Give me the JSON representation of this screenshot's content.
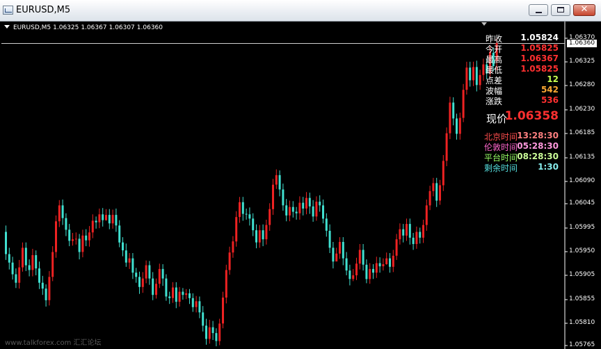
{
  "window": {
    "title": "EURUSD,M5",
    "buttons": {
      "minimize": "minimize-icon",
      "maximize": "maximize-icon",
      "close": "✕"
    }
  },
  "chart_header": {
    "symbol": "EURUSD,M5",
    "open": "1.06325",
    "high": "1.06367",
    "low": "1.06307",
    "close": "1.06360"
  },
  "info_panel": {
    "rows": [
      {
        "label": "昨收",
        "value": "1.05824",
        "color": "#ffffff"
      },
      {
        "label": "今开",
        "value": "1.05825",
        "color": "#ff3030"
      },
      {
        "label": "最高",
        "value": "1.06367",
        "color": "#ff3030"
      },
      {
        "label": "最低",
        "value": "1.05825",
        "color": "#ff3030"
      },
      {
        "label": "点差",
        "value": "12",
        "color": "#c8ff50"
      },
      {
        "label": "波幅",
        "value": "542",
        "color": "#ffaa33"
      },
      {
        "label": "涨跌",
        "value": "536",
        "color": "#ff3030"
      }
    ],
    "current_price": {
      "label": "现价",
      "value": "1.06358"
    },
    "times": [
      {
        "label": "北京时间",
        "value": "13:28:30",
        "label_color": "#ff4d4d",
        "value_color": "#ff8080"
      },
      {
        "label": "伦敦时间",
        "value": "05:28:30",
        "label_color": "#ff66cc",
        "value_color": "#ff99dd"
      },
      {
        "label": "平台时间",
        "value": "08:28:30",
        "label_color": "#99ff66",
        "value_color": "#ccff99"
      },
      {
        "label": "剩余时间",
        "value": "1:30",
        "label_color": "#55dddd",
        "value_color": "#88eeee"
      }
    ]
  },
  "price_axis": {
    "labels": [
      "1.06370",
      "1.06325",
      "1.06280",
      "1.06230",
      "1.06185",
      "1.06135",
      "1.06090",
      "1.06045",
      "1.05995",
      "1.05950",
      "1.05905",
      "1.05855",
      "1.05810",
      "1.05765"
    ],
    "current_price_tag": "1.06360",
    "current_price_line": 1.0636
  },
  "colors": {
    "bull": "#ee2222",
    "bear": "#40e0d0",
    "background": "#000000",
    "grid": "#ffffff"
  },
  "chart_data": {
    "type": "candlestick",
    "title": "EURUSD,M5",
    "ylim": [
      1.0576,
      1.0642
    ],
    "candles": [
      [
        1.06002,
        1.0596,
        1.06014,
        1.05949
      ],
      [
        1.0596,
        1.05944,
        1.05972,
        1.05931
      ],
      [
        1.05944,
        1.05922,
        1.05955,
        1.05912
      ],
      [
        1.05922,
        1.05906,
        1.05933,
        1.05896
      ],
      [
        1.05906,
        1.05935,
        1.05949,
        1.05895
      ],
      [
        1.05935,
        1.05972,
        1.05982,
        1.05927
      ],
      [
        1.05972,
        1.05939,
        1.05982,
        1.05928
      ],
      [
        1.05939,
        1.0593,
        1.0595,
        1.05918
      ],
      [
        1.0593,
        1.05958,
        1.0597,
        1.05918
      ],
      [
        1.05958,
        1.05933,
        1.05967,
        1.0592
      ],
      [
        1.05933,
        1.05906,
        1.05946,
        1.05894
      ],
      [
        1.05906,
        1.05895,
        1.05919,
        1.05883
      ],
      [
        1.05895,
        1.05873,
        1.05903,
        1.05861
      ],
      [
        1.05873,
        1.05917,
        1.05928,
        1.05863
      ],
      [
        1.05917,
        1.05964,
        1.05975,
        1.05909
      ],
      [
        1.05964,
        1.06022,
        1.06033,
        1.05953
      ],
      [
        1.06022,
        1.06052,
        1.06062,
        1.06011
      ],
      [
        1.06052,
        1.06028,
        1.06063,
        1.06015
      ],
      [
        1.06028,
        1.06006,
        1.06037,
        1.05994
      ],
      [
        1.06006,
        1.05985,
        1.06017,
        1.05975
      ],
      [
        1.05985,
        1.05988,
        1.06,
        1.05976
      ],
      [
        1.05988,
        1.05989,
        1.06001,
        1.05978
      ],
      [
        1.05989,
        1.05964,
        1.05998,
        1.0595
      ],
      [
        1.05964,
        1.05995,
        1.06006,
        1.05954
      ],
      [
        1.05995,
        1.05986,
        1.06007,
        1.05975
      ],
      [
        1.05986,
        1.06001,
        1.06013,
        1.05974
      ],
      [
        1.06001,
        1.06023,
        1.06035,
        1.0599
      ],
      [
        1.06023,
        1.0602,
        1.06031,
        1.06008
      ],
      [
        1.0602,
        1.06035,
        1.06046,
        1.06009
      ],
      [
        1.06035,
        1.06024,
        1.06047,
        1.06012
      ],
      [
        1.06024,
        1.06034,
        1.06045,
        1.06023
      ],
      [
        1.06034,
        1.06018,
        1.06045,
        1.06007
      ],
      [
        1.06018,
        1.06034,
        1.06044,
        1.06008
      ],
      [
        1.06034,
        1.06014,
        1.06046,
        1.06002
      ],
      [
        1.06014,
        1.05982,
        1.06024,
        1.05973
      ],
      [
        1.05982,
        1.05967,
        1.05992,
        1.05956
      ],
      [
        1.05967,
        1.05944,
        1.0598,
        1.05936
      ],
      [
        1.05944,
        1.05952,
        1.05962,
        1.05932
      ],
      [
        1.05952,
        1.05925,
        1.05962,
        1.05913
      ],
      [
        1.05925,
        1.05917,
        1.05934,
        1.05906
      ],
      [
        1.05917,
        1.05898,
        1.05927,
        1.05885
      ],
      [
        1.05898,
        1.05914,
        1.05926,
        1.05887
      ],
      [
        1.05914,
        1.05939,
        1.05948,
        1.05905
      ],
      [
        1.05939,
        1.05914,
        1.05947,
        1.05902
      ],
      [
        1.05914,
        1.05883,
        1.05926,
        1.05873
      ],
      [
        1.05883,
        1.05904,
        1.05914,
        1.05876
      ],
      [
        1.05904,
        1.05932,
        1.05942,
        1.05896
      ],
      [
        1.05932,
        1.05914,
        1.05941,
        1.059
      ],
      [
        1.05914,
        1.0588,
        1.05922,
        1.05872
      ],
      [
        1.0588,
        1.05877,
        1.05889,
        1.05866
      ],
      [
        1.05877,
        1.05897,
        1.05907,
        1.05868
      ],
      [
        1.05897,
        1.0587,
        1.05907,
        1.05858
      ],
      [
        1.0587,
        1.05889,
        1.05898,
        1.05861
      ],
      [
        1.05889,
        1.05883,
        1.05896,
        1.05874
      ],
      [
        1.05883,
        1.05886,
        1.05894,
        1.05875
      ],
      [
        1.05886,
        1.05877,
        1.05894,
        1.05866
      ],
      [
        1.05877,
        1.0586,
        1.05886,
        1.05851
      ],
      [
        1.0586,
        1.05871,
        1.05881,
        1.0585
      ],
      [
        1.05871,
        1.0585,
        1.0588,
        1.05839
      ],
      [
        1.0585,
        1.05825,
        1.05862,
        1.05814
      ],
      [
        1.05825,
        1.058,
        1.05838,
        1.05789
      ],
      [
        1.058,
        1.05822,
        1.05836,
        1.05791
      ],
      [
        1.05822,
        1.05811,
        1.05834,
        1.05798
      ],
      [
        1.05811,
        1.05796,
        1.0582,
        1.05786
      ],
      [
        1.05796,
        1.05829,
        1.05838,
        1.05788
      ],
      [
        1.05829,
        1.05878,
        1.05889,
        1.0582
      ],
      [
        1.05878,
        1.0593,
        1.0594,
        1.05867
      ],
      [
        1.0593,
        1.05963,
        1.05974,
        1.05921
      ],
      [
        1.05963,
        1.05984,
        1.05994,
        1.05953
      ],
      [
        1.05984,
        1.0603,
        1.06041,
        1.05974
      ],
      [
        1.0603,
        1.06058,
        1.06068,
        1.06019
      ],
      [
        1.06058,
        1.06036,
        1.06068,
        1.06023
      ],
      [
        1.06036,
        1.06035,
        1.06046,
        1.06025
      ],
      [
        1.06035,
        1.06027,
        1.06048,
        1.06014
      ],
      [
        1.06027,
        1.06005,
        1.06037,
        1.05994
      ],
      [
        1.06005,
        1.05982,
        1.06016,
        1.05971
      ],
      [
        1.05982,
        1.06005,
        1.06015,
        1.05972
      ],
      [
        1.06005,
        1.05988,
        1.06016,
        1.05975
      ],
      [
        1.05988,
        1.06015,
        1.06025,
        1.05978
      ],
      [
        1.06015,
        1.06045,
        1.06056,
        1.06004
      ],
      [
        1.06045,
        1.06091,
        1.06102,
        1.06034
      ],
      [
        1.06091,
        1.06109,
        1.0612,
        1.06083
      ],
      [
        1.06109,
        1.06082,
        1.06118,
        1.06069
      ],
      [
        1.06082,
        1.06052,
        1.06093,
        1.06042
      ],
      [
        1.06052,
        1.06033,
        1.06064,
        1.06022
      ],
      [
        1.06033,
        1.06049,
        1.06061,
        1.06022
      ],
      [
        1.06049,
        1.0604,
        1.0606,
        1.06029
      ],
      [
        1.0604,
        1.06037,
        1.06049,
        1.06025
      ],
      [
        1.06037,
        1.06057,
        1.06069,
        1.06025
      ],
      [
        1.06057,
        1.06046,
        1.06068,
        1.06033
      ],
      [
        1.06046,
        1.06066,
        1.06077,
        1.06035
      ],
      [
        1.06066,
        1.0605,
        1.06076,
        1.06036
      ],
      [
        1.0605,
        1.06031,
        1.06062,
        1.06021
      ],
      [
        1.06031,
        1.06059,
        1.06069,
        1.06023
      ],
      [
        1.06059,
        1.06052,
        1.06071,
        1.0604
      ],
      [
        1.06052,
        1.06027,
        1.06063,
        1.06018
      ],
      [
        1.06027,
        1.06004,
        1.06037,
        1.05993
      ],
      [
        1.06004,
        1.05972,
        1.06016,
        1.05962
      ],
      [
        1.05972,
        1.05946,
        1.05983,
        1.05933
      ],
      [
        1.05946,
        1.05961,
        1.05972,
        1.05952
      ],
      [
        1.05961,
        1.05983,
        1.05992,
        1.05951
      ],
      [
        1.05983,
        1.05952,
        1.05992,
        1.05939
      ],
      [
        1.05952,
        1.05929,
        1.05964,
        1.0592
      ],
      [
        1.05929,
        1.05913,
        1.0594,
        1.05901
      ],
      [
        1.05913,
        1.0592,
        1.05932,
        1.05909
      ],
      [
        1.0592,
        1.05942,
        1.05953,
        1.05911
      ],
      [
        1.05942,
        1.05968,
        1.05979,
        1.05931
      ],
      [
        1.05968,
        1.0594,
        1.05979,
        1.05929
      ],
      [
        1.0594,
        1.05913,
        1.0595,
        1.05905
      ],
      [
        1.05913,
        1.05932,
        1.05943,
        1.05904
      ],
      [
        1.05932,
        1.05925,
        1.05941,
        1.05913
      ],
      [
        1.05925,
        1.05943,
        1.05955,
        1.05915
      ],
      [
        1.05943,
        1.05937,
        1.05954,
        1.05925
      ],
      [
        1.05937,
        1.05941,
        1.05952,
        1.05929
      ],
      [
        1.05941,
        1.05952,
        1.05963,
        1.0594
      ],
      [
        1.05952,
        1.05936,
        1.05962,
        1.05925
      ],
      [
        1.05936,
        1.05957,
        1.05968,
        1.05926
      ],
      [
        1.05957,
        1.05988,
        1.05998,
        1.05949
      ],
      [
        1.05988,
        1.06007,
        1.06018,
        1.05978
      ],
      [
        1.06007,
        1.05995,
        1.06017,
        1.05982
      ],
      [
        1.05995,
        1.06017,
        1.06027,
        1.05985
      ],
      [
        1.06017,
        1.05991,
        1.06027,
        1.05978
      ],
      [
        1.05991,
        1.05979,
        1.06,
        1.05968
      ],
      [
        1.05979,
        1.06002,
        1.06012,
        1.0597
      ],
      [
        1.06002,
        1.05991,
        1.0601,
        1.0598
      ],
      [
        1.05991,
        1.06015,
        1.06025,
        1.05981
      ],
      [
        1.06015,
        1.06052,
        1.06063,
        1.06004
      ],
      [
        1.06052,
        1.06079,
        1.06089,
        1.06043
      ],
      [
        1.06079,
        1.06094,
        1.06104,
        1.06069
      ],
      [
        1.06094,
        1.06061,
        1.06104,
        1.06049
      ],
      [
        1.06061,
        1.0609,
        1.061,
        1.06053
      ],
      [
        1.0609,
        1.06136,
        1.06147,
        1.06079
      ],
      [
        1.06136,
        1.06188,
        1.06199,
        1.06126
      ],
      [
        1.06188,
        1.06246,
        1.06257,
        1.06177
      ],
      [
        1.06246,
        1.06216,
        1.06256,
        1.06203
      ],
      [
        1.06216,
        1.06187,
        1.06225,
        1.06176
      ],
      [
        1.06187,
        1.06217,
        1.06227,
        1.06176
      ],
      [
        1.06217,
        1.0627,
        1.06281,
        1.06209
      ],
      [
        1.0627,
        1.06312,
        1.06323,
        1.06261
      ],
      [
        1.06312,
        1.06288,
        1.06323,
        1.06276
      ],
      [
        1.06288,
        1.06313,
        1.06323,
        1.06277
      ],
      [
        1.06313,
        1.06279,
        1.06325,
        1.06267
      ],
      [
        1.06279,
        1.06298,
        1.06308,
        1.0627
      ],
      [
        1.06298,
        1.06318,
        1.06329,
        1.06287
      ],
      [
        1.06318,
        1.06301,
        1.06329,
        1.0629
      ],
      [
        1.06301,
        1.06341,
        1.06352,
        1.06293
      ],
      [
        1.0634,
        1.06315,
        1.0635,
        1.06305
      ],
      [
        1.06325,
        1.06358,
        1.06367,
        1.06307
      ]
    ]
  }
}
